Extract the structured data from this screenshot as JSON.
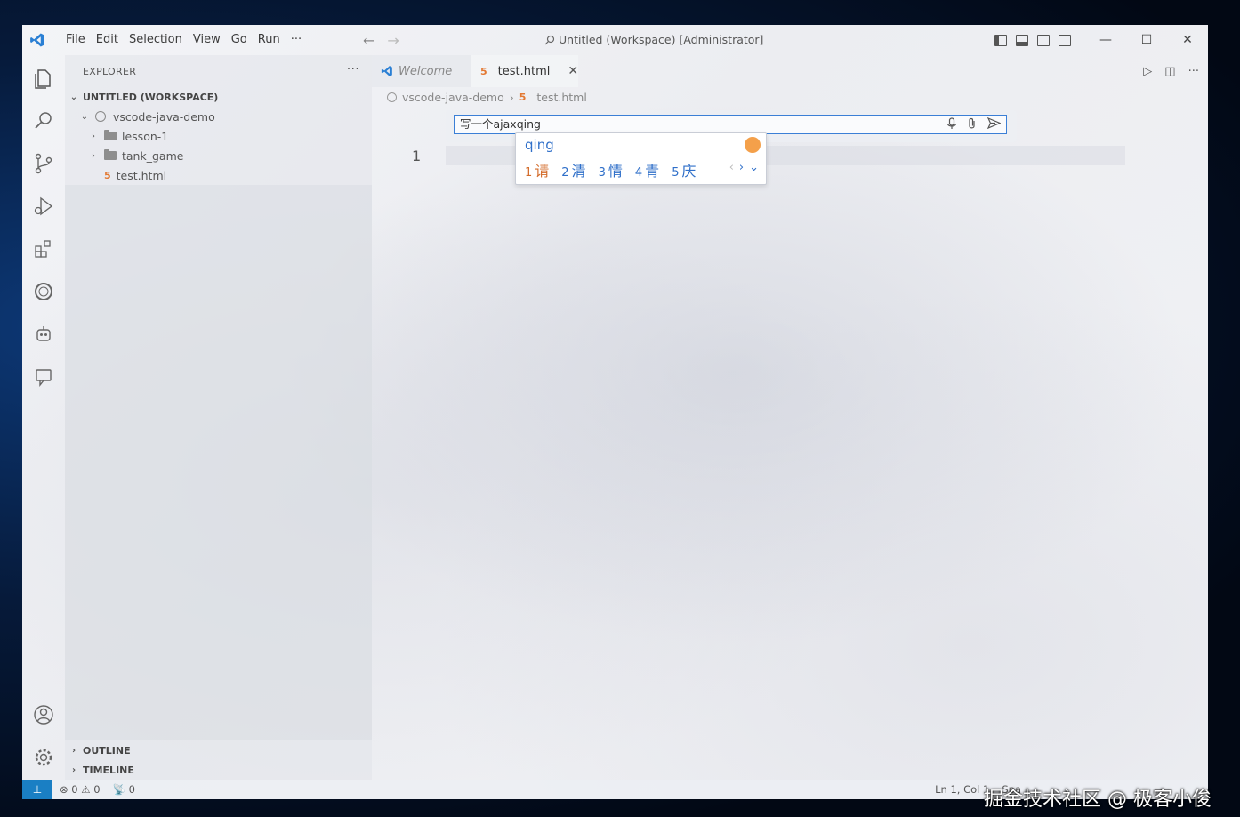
{
  "window": {
    "title": "Untitled (Workspace) [Administrator]"
  },
  "menu": [
    "File",
    "Edit",
    "Selection",
    "View",
    "Go",
    "Run",
    "···"
  ],
  "sidebar": {
    "header": "EXPLORER",
    "more": "···",
    "workspace": "UNTITLED (WORKSPACE)",
    "project": "vscode-java-demo",
    "items": [
      {
        "label": "lesson-1",
        "type": "folder"
      },
      {
        "label": "tank_game",
        "type": "folder"
      },
      {
        "label": "test.html",
        "type": "file"
      }
    ],
    "outline": "OUTLINE",
    "timeline": "TIMELINE"
  },
  "tabs": [
    {
      "label": "Welcome",
      "active": false
    },
    {
      "label": "test.html",
      "active": true
    }
  ],
  "breadcrumb": [
    "vscode-java-demo",
    "test.html"
  ],
  "editor": {
    "line_number": "1"
  },
  "chat": {
    "input_value": "写一个ajaxqing"
  },
  "ime": {
    "composition": "qing",
    "candidates": [
      {
        "num": "1",
        "text": "请"
      },
      {
        "num": "2",
        "text": "清"
      },
      {
        "num": "3",
        "text": "情"
      },
      {
        "num": "4",
        "text": "青"
      },
      {
        "num": "5",
        "text": "庆"
      }
    ]
  },
  "status": {
    "errors": "0",
    "warnings": "0",
    "ports": "0",
    "position": "Ln 1, Col 1",
    "spaces": "Spa"
  },
  "watermark": "掘金技术社区 @ 极客小俊",
  "colors": {
    "accent": "#3b7fd6",
    "remote": "#1a7fc4",
    "html_icon": "#e37933",
    "ime_text": "#2f6fc9",
    "ime_first": "#d36b2a"
  }
}
